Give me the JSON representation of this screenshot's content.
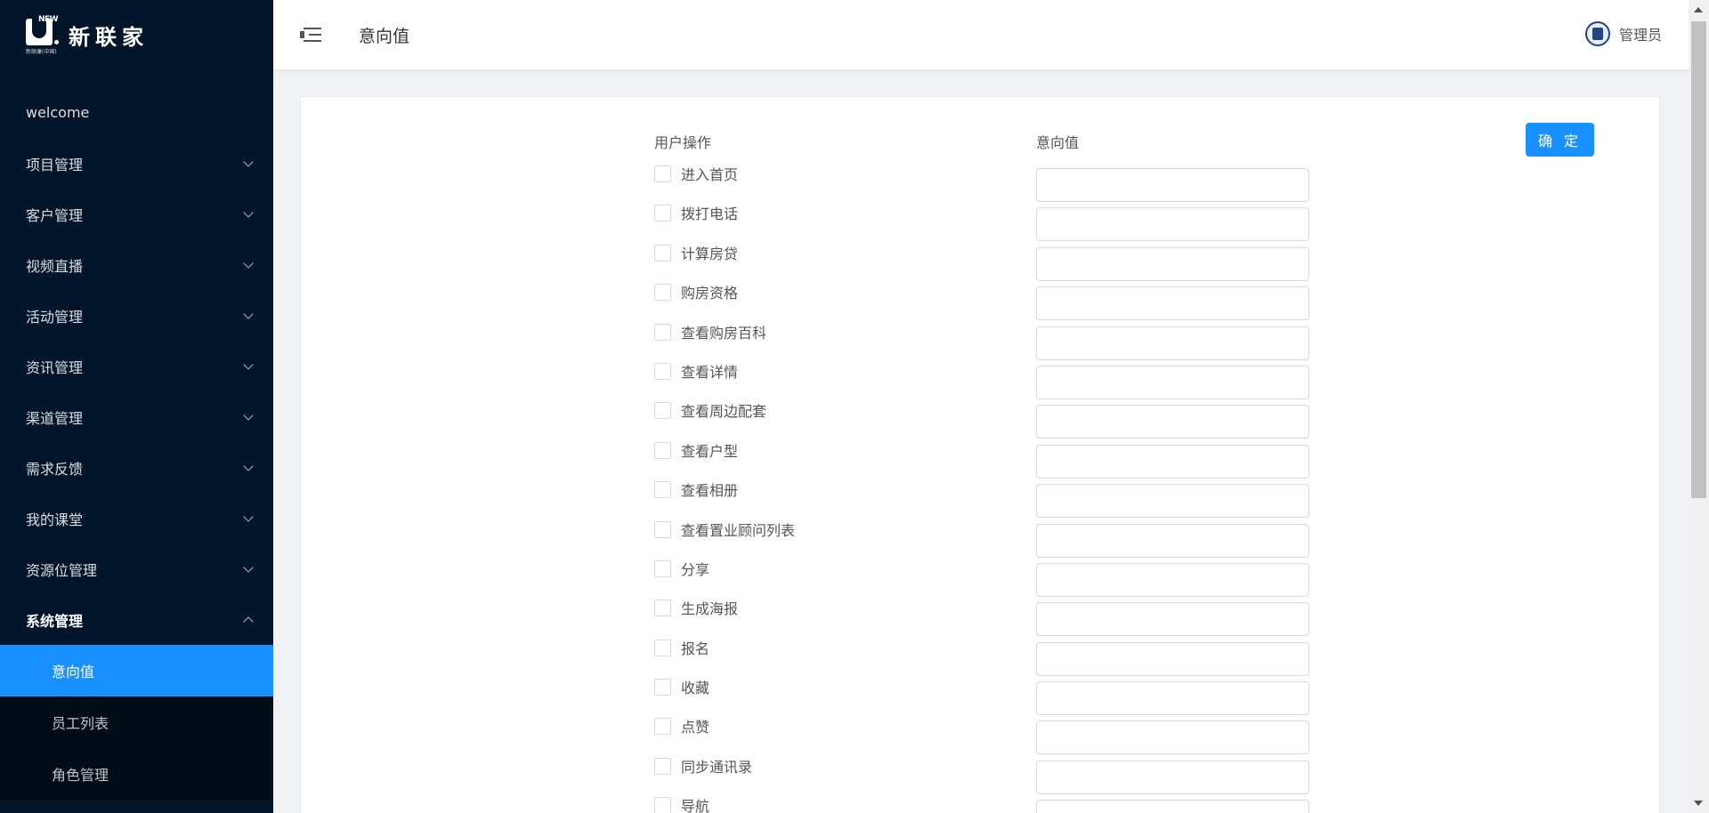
{
  "sidebar": {
    "logo": {
      "text": "新联家",
      "mark_top": "NEW",
      "mark_sub": "新联康(中国)"
    },
    "welcome": "welcome",
    "menu": [
      {
        "label": "项目管理",
        "open": false
      },
      {
        "label": "客户管理",
        "open": false
      },
      {
        "label": "视频直播",
        "open": false
      },
      {
        "label": "活动管理",
        "open": false
      },
      {
        "label": "资讯管理",
        "open": false
      },
      {
        "label": "渠道管理",
        "open": false
      },
      {
        "label": "需求反馈",
        "open": false
      },
      {
        "label": "我的课堂",
        "open": false
      },
      {
        "label": "资源位管理",
        "open": false
      },
      {
        "label": "系统管理",
        "open": true
      }
    ],
    "submenu": [
      {
        "label": "意向值",
        "active": true
      },
      {
        "label": "员工列表",
        "active": false
      },
      {
        "label": "角色管理",
        "active": false
      }
    ]
  },
  "header": {
    "title": "意向值",
    "user_name": "管理员"
  },
  "content": {
    "col_action": "用户操作",
    "col_value": "意向值",
    "confirm_label": "确 定",
    "rows": [
      {
        "label": "进入首页",
        "checked": false,
        "value": ""
      },
      {
        "label": "拨打电话",
        "checked": false,
        "value": ""
      },
      {
        "label": "计算房贷",
        "checked": false,
        "value": ""
      },
      {
        "label": "购房资格",
        "checked": false,
        "value": ""
      },
      {
        "label": "查看购房百科",
        "checked": false,
        "value": ""
      },
      {
        "label": "查看详情",
        "checked": false,
        "value": ""
      },
      {
        "label": "查看周边配套",
        "checked": false,
        "value": ""
      },
      {
        "label": "查看户型",
        "checked": false,
        "value": ""
      },
      {
        "label": "查看相册",
        "checked": false,
        "value": ""
      },
      {
        "label": "查看置业顾问列表",
        "checked": false,
        "value": ""
      },
      {
        "label": "分享",
        "checked": false,
        "value": ""
      },
      {
        "label": "生成海报",
        "checked": false,
        "value": ""
      },
      {
        "label": "报名",
        "checked": false,
        "value": ""
      },
      {
        "label": "收藏",
        "checked": false,
        "value": ""
      },
      {
        "label": "点赞",
        "checked": false,
        "value": ""
      },
      {
        "label": "同步通讯录",
        "checked": false,
        "value": ""
      },
      {
        "label": "导航",
        "checked": false,
        "value": ""
      }
    ]
  },
  "colors": {
    "sidebar_bg": "#001529",
    "submenu_bg": "#000c17",
    "primary": "#1890ff",
    "page_bg": "#f0f2f5"
  }
}
